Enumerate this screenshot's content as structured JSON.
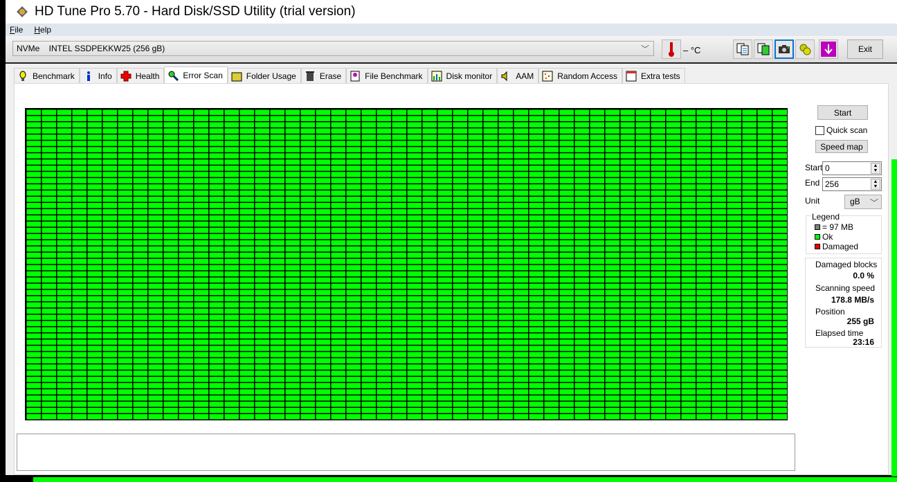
{
  "window": {
    "title": "HD Tune Pro 5.70 - Hard Disk/SSD Utility (trial version)"
  },
  "menu": [
    {
      "label": "File",
      "key": "F",
      "rest": "ile"
    },
    {
      "label": "Help",
      "key": "H",
      "rest": "elp"
    }
  ],
  "toolbar": {
    "drive": "NVMe    INTEL SSDPEKKW25 (256 gB)",
    "temperature": "– °C",
    "exit_label": "Exit",
    "icons": [
      "copy-text-icon",
      "copy-screenshot-icon",
      "camera-icon",
      "options-icon",
      "save-download-icon"
    ]
  },
  "tabs": [
    {
      "label": "Benchmark",
      "icon": "lightbulb-icon"
    },
    {
      "label": "Info",
      "icon": "info-icon"
    },
    {
      "label": "Health",
      "icon": "health-cross-icon"
    },
    {
      "label": "Error Scan",
      "icon": "magnifier-icon",
      "active": true
    },
    {
      "label": "Folder Usage",
      "icon": "folder-icon"
    },
    {
      "label": "Erase",
      "icon": "trash-icon"
    },
    {
      "label": "File Benchmark",
      "icon": "file-benchmark-icon"
    },
    {
      "label": "Disk monitor",
      "icon": "disk-monitor-icon"
    },
    {
      "label": "AAM",
      "icon": "speaker-icon"
    },
    {
      "label": "Random Access",
      "icon": "random-access-icon"
    },
    {
      "label": "Extra tests",
      "icon": "extra-tests-icon"
    }
  ],
  "scan": {
    "start_button": "Start",
    "quick_scan_label": "Quick scan",
    "quick_scan_checked": false,
    "speed_map_button": "Speed map",
    "start_label": "Start",
    "start_value": "0",
    "end_label": "End",
    "end_value": "256",
    "unit_label": "Unit",
    "unit_value": "gB",
    "legend": {
      "title": "Legend",
      "block": "= 97 MB",
      "ok": "Ok",
      "damaged": "Damaged"
    },
    "colors": {
      "ok": "#00ff00",
      "damaged": "#ff0000",
      "block": "#808080"
    },
    "block_status": "all ok",
    "stats": {
      "damaged_label": "Damaged blocks",
      "damaged_value": "0.0 %",
      "speed_label": "Scanning speed",
      "speed_value": "178.8 MB/s",
      "position_label": "Position",
      "position_value": "255 gB",
      "elapsed_label": "Elapsed time",
      "elapsed_value": "23:16"
    }
  }
}
